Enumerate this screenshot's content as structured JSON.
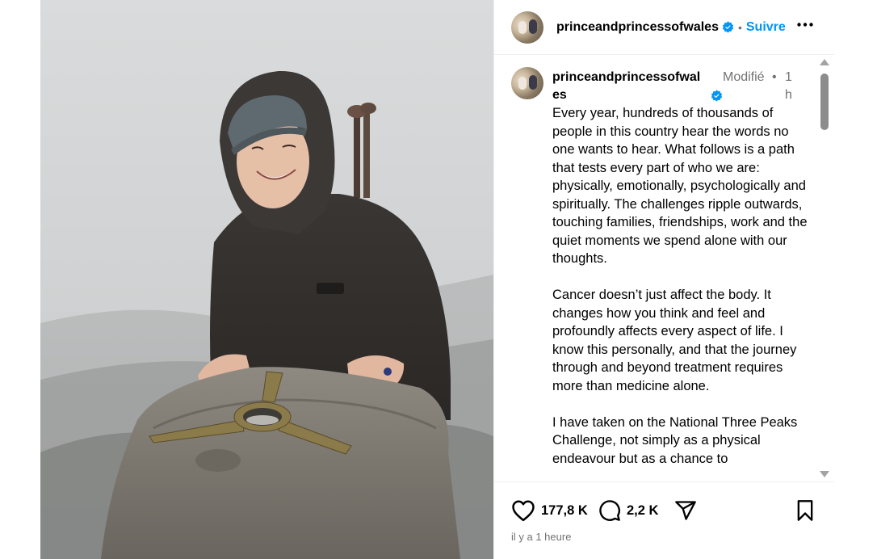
{
  "post": {
    "username": "princeandprincessofwales",
    "follow_label": "Suivre",
    "separator": "•",
    "caption": {
      "username": "princeandprincessofwales",
      "edited_label": "Modifié",
      "separator": "•",
      "time": "1 h",
      "paragraphs": [
        "Every year, hundreds of thousands of people in this country hear the words no one wants to hear. What follows is a path that tests every part of who we are: physically, emotionally, psychologically and spiritually. The challenges ripple outwards, touching families, friendships, work and the quiet moments we spend alone with our thoughts.",
        "Cancer doesn’t just affect the body. It changes how you think and feel and profoundly affects every aspect of life. I know this personally, and that the journey through and beyond treatment requires more than medicine alone.",
        "I have taken on the National Three Peaks Challenge, not simply as a physical endeavour but as a chance to"
      ]
    },
    "likes_count": "177,8 K",
    "comments_count": "2,2 K",
    "timestamp": "il y a 1 heure"
  },
  "colors": {
    "accent_blue": "#0095f6",
    "secondary_text": "#737373",
    "divider": "#efefef"
  },
  "icons": {
    "verified": "verified-badge-icon",
    "more": "more-options-icon",
    "like": "heart-icon",
    "comment": "comment-bubble-icon",
    "share": "share-send-icon",
    "save": "bookmark-icon"
  }
}
